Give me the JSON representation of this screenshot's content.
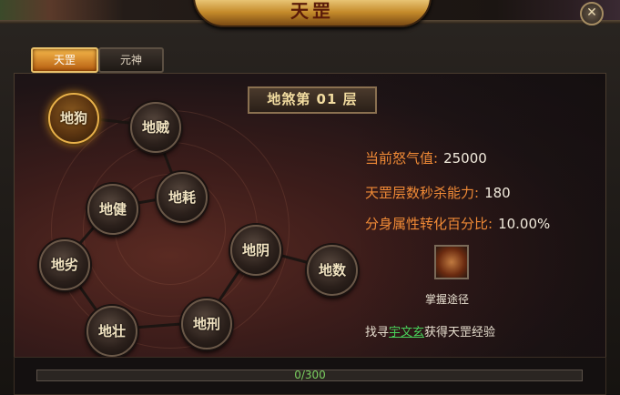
{
  "window": {
    "title": "天罡",
    "close_icon": "close-x-icon"
  },
  "tabs": [
    {
      "label": "天罡",
      "active": true
    },
    {
      "label": "元神",
      "active": false
    }
  ],
  "level_banner": "地煞第 01 层",
  "nodes": [
    {
      "label": "地狗",
      "lit": true
    },
    {
      "label": "地贼",
      "lit": false
    },
    {
      "label": "地耗",
      "lit": false
    },
    {
      "label": "地健",
      "lit": false
    },
    {
      "label": "地劣",
      "lit": false
    },
    {
      "label": "地壮",
      "lit": false
    },
    {
      "label": "地刑",
      "lit": false
    },
    {
      "label": "地阴",
      "lit": false
    },
    {
      "label": "地数",
      "lit": false
    }
  ],
  "stats": [
    {
      "key": "当前怒气值:",
      "value": "25000"
    },
    {
      "key": "天罡层数秒杀能力:",
      "value": "180"
    },
    {
      "key": "分身属性转化百分比:",
      "value": "10.00%"
    }
  ],
  "item": {
    "label": "掌握途径",
    "icon": "skill-scroll-icon"
  },
  "hint": {
    "prefix": "找寻",
    "link": "宇文玄",
    "suffix": "获得天罡经验"
  },
  "progress": {
    "current": 0,
    "max": 300,
    "text": "0/300",
    "color": "#6ac04a"
  }
}
